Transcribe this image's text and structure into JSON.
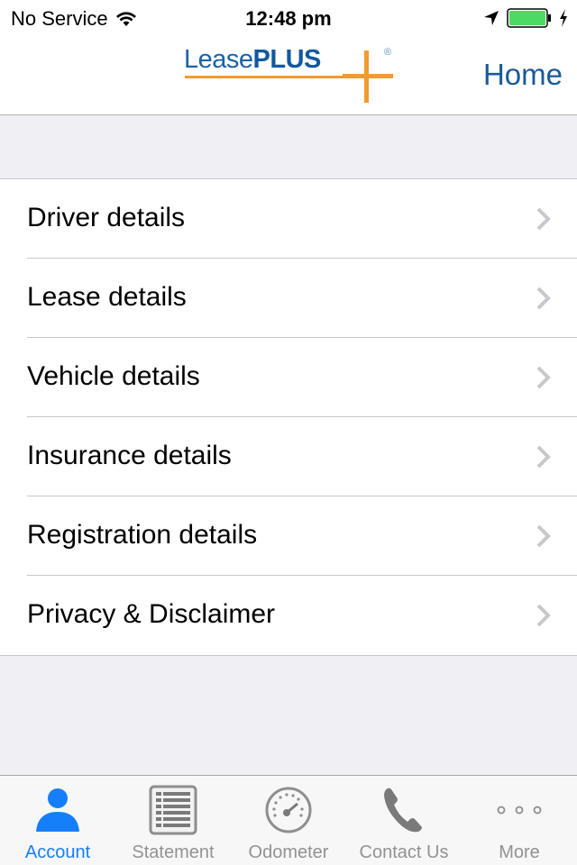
{
  "status_bar": {
    "carrier": "No Service",
    "time": "12:48 pm",
    "icons": [
      "wifi-icon",
      "location-arrow-icon",
      "battery-icon",
      "charging-bolt-icon"
    ],
    "battery_color": "#4cd964"
  },
  "nav": {
    "logo": {
      "word1": "Lease",
      "word2": "PLUS",
      "reg": "®"
    },
    "home_label": "Home",
    "accent": "#1a5a98",
    "logo_orange": "#f29a2e"
  },
  "menu": {
    "items": [
      {
        "label": "Driver details",
        "icon": "chevron-right-icon"
      },
      {
        "label": "Lease details",
        "icon": "chevron-right-icon"
      },
      {
        "label": "Vehicle details",
        "icon": "chevron-right-icon"
      },
      {
        "label": "Insurance details",
        "icon": "chevron-right-icon"
      },
      {
        "label": "Registration details",
        "icon": "chevron-right-icon"
      },
      {
        "label": "Privacy & Disclaimer",
        "icon": "chevron-right-icon"
      }
    ]
  },
  "tab_bar": {
    "active_color": "#157efb",
    "inactive_color": "#929292",
    "tabs": [
      {
        "label": "Account",
        "icon": "person-icon",
        "active": true
      },
      {
        "label": "Statement",
        "icon": "statement-list-icon",
        "active": false
      },
      {
        "label": "Odometer",
        "icon": "odometer-gauge-icon",
        "active": false
      },
      {
        "label": "Contact Us",
        "icon": "phone-icon",
        "active": false
      },
      {
        "label": "More",
        "icon": "more-dots-icon",
        "active": false
      }
    ]
  }
}
